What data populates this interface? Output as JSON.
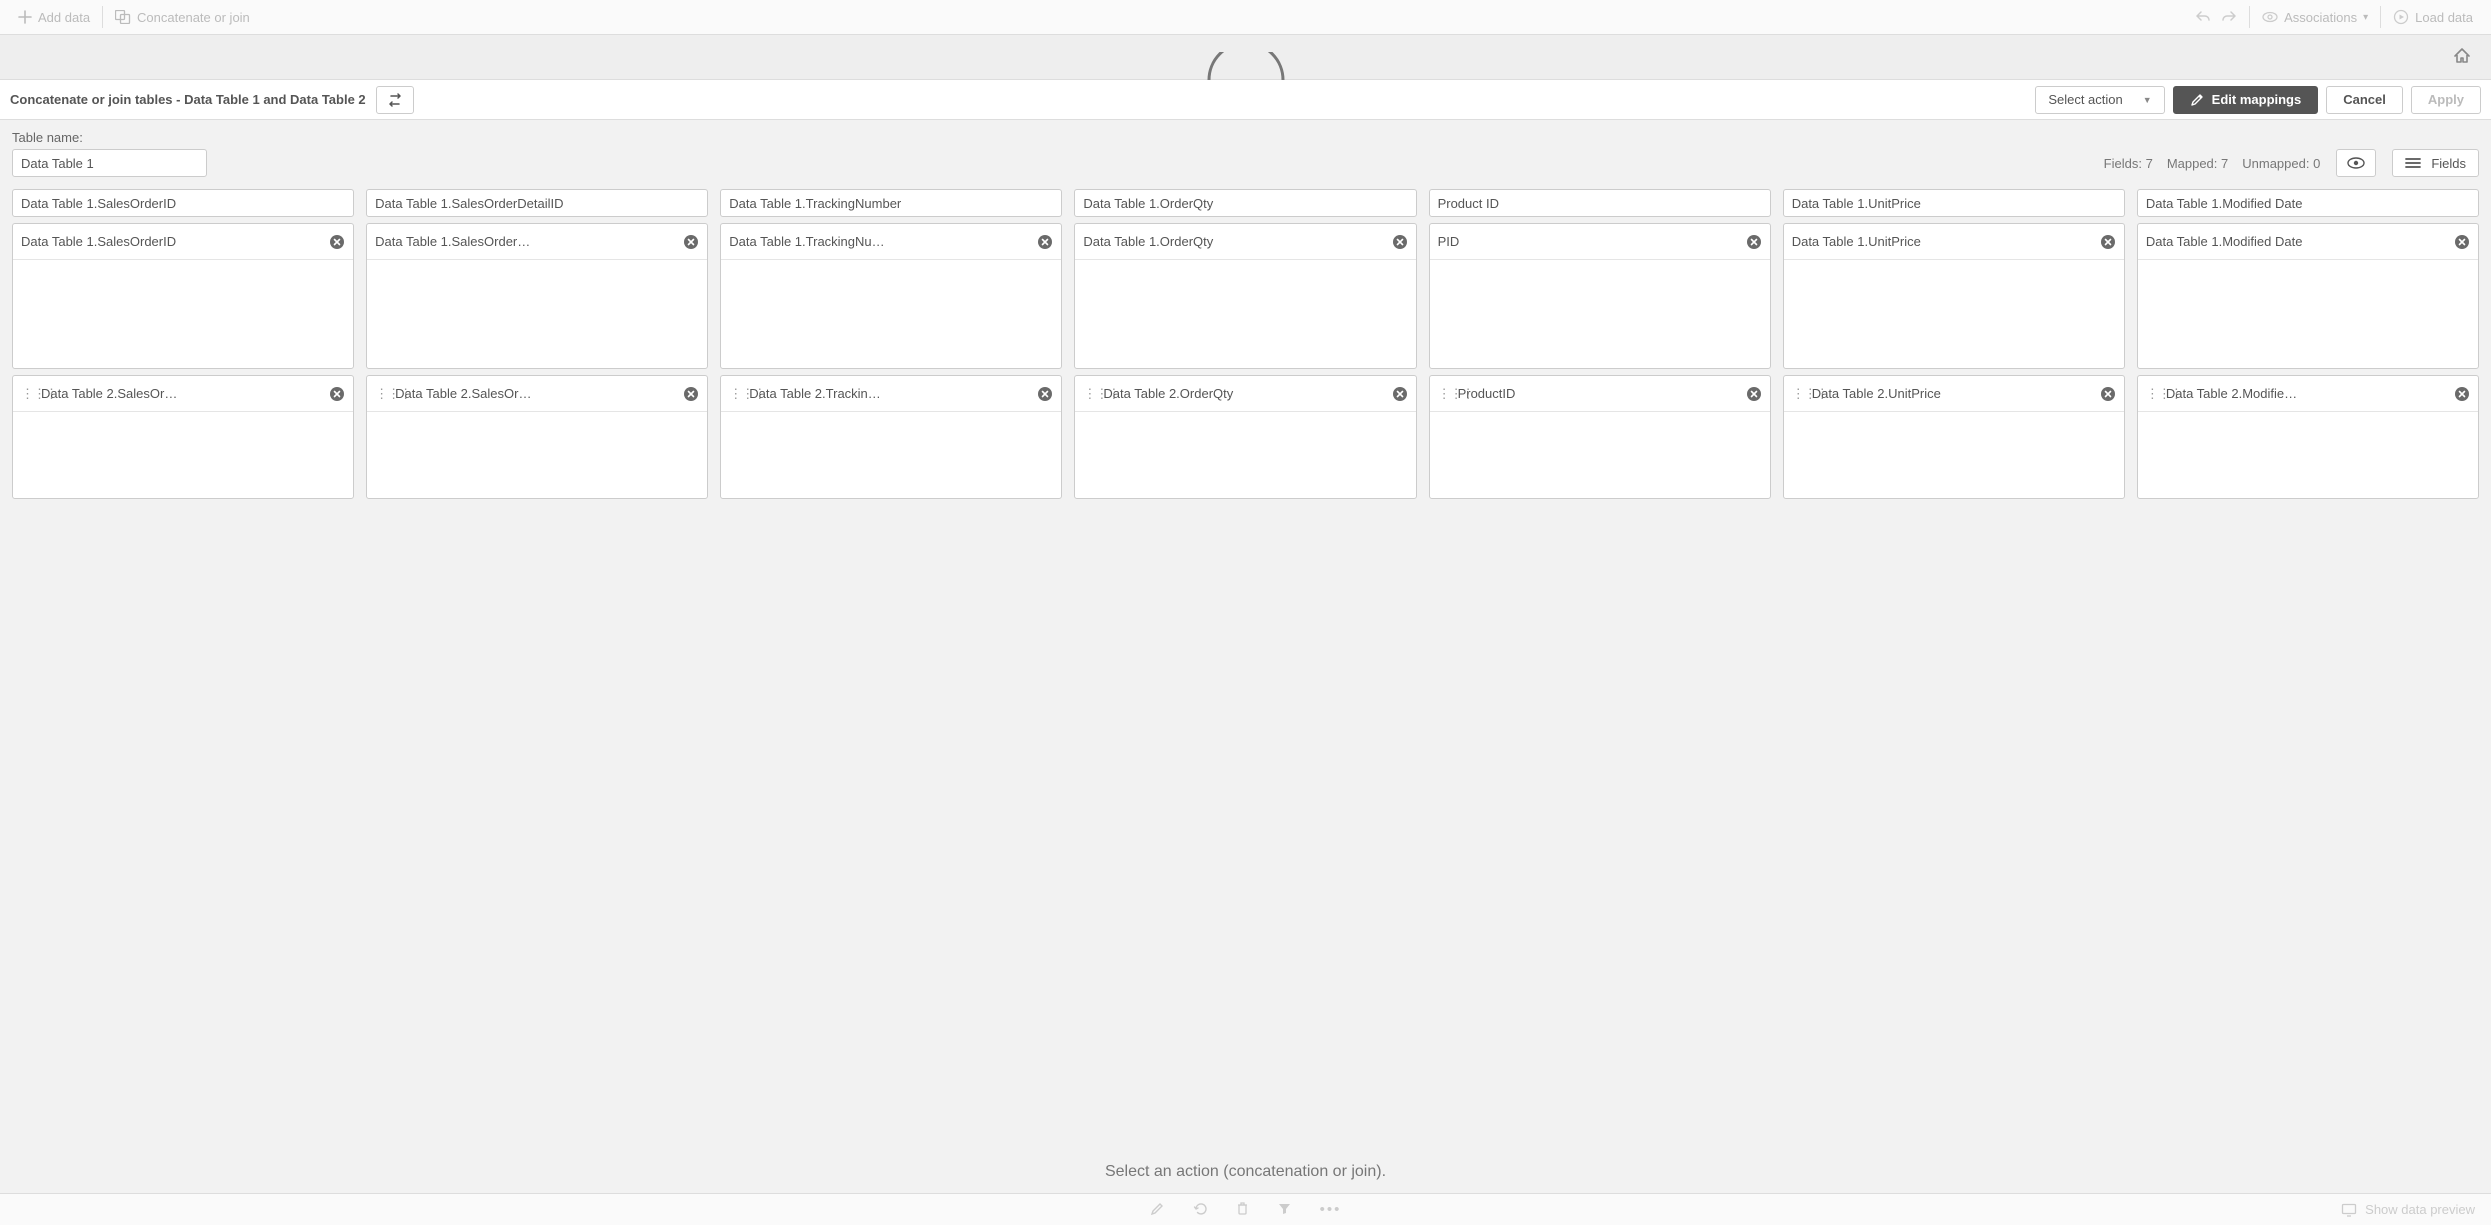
{
  "toolbar": {
    "add_data": "Add data",
    "concat_join": "Concatenate or join",
    "associations": "Associations",
    "load_data": "Load data"
  },
  "actionbar": {
    "title": "Concatenate or join tables - Data Table 1 and Data Table 2",
    "select_action": "Select action",
    "edit_mappings": "Edit mappings",
    "cancel": "Cancel",
    "apply": "Apply"
  },
  "tname": {
    "label": "Table name:",
    "value": "Data Table 1"
  },
  "stats": {
    "fields": "Fields: 7",
    "mapped": "Mapped: 7",
    "unmapped": "Unmapped: 0"
  },
  "fields_btn": "Fields",
  "columns": [
    {
      "header": "Data Table 1.SalesOrderID",
      "row1": "Data Table 1.SalesOrderID",
      "row2": "Data Table 2.SalesOr…"
    },
    {
      "header": "Data Table 1.SalesOrderDetailID",
      "row1": "Data Table 1.SalesOrder…",
      "row2": "Data Table 2.SalesOr…"
    },
    {
      "header": "Data Table 1.TrackingNumber",
      "row1": "Data Table 1.TrackingNu…",
      "row2": "Data Table 2.Trackin…"
    },
    {
      "header": "Data Table 1.OrderQty",
      "row1": "Data Table 1.OrderQty",
      "row2": "Data Table 2.OrderQty"
    },
    {
      "header": "Product ID",
      "row1": "PID",
      "row2": "ProductID"
    },
    {
      "header": "Data Table 1.UnitPrice",
      "row1": "Data Table 1.UnitPrice",
      "row2": "Data Table 2.UnitPrice"
    },
    {
      "header": "Data Table 1.Modified Date",
      "row1": "Data Table 1.Modified Date",
      "row2": "Data Table 2.Modifie…"
    }
  ],
  "prompt": "Select an action (concatenation or join).",
  "footer": {
    "show_preview": "Show data preview"
  }
}
